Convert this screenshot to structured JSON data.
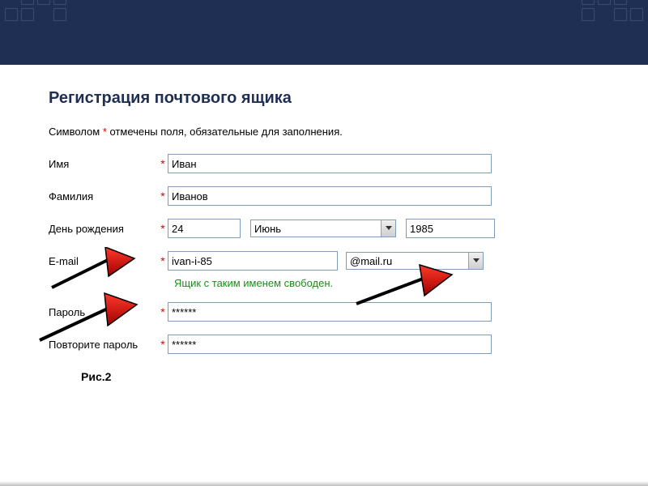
{
  "title": "Регистрация почтового ящика",
  "note_pre": "Символом ",
  "note_star": "*",
  "note_post": " отмечены поля, обязательные для заполнения.",
  "labels": {
    "first_name": "Имя",
    "last_name": "Фамилия",
    "birthday": "День рождения",
    "email": "E-mail",
    "password": "Пароль",
    "password_confirm": "Повторите пароль"
  },
  "values": {
    "first_name": "Иван",
    "last_name": "Иванов",
    "day": "24",
    "month": "Июнь",
    "year": "1985",
    "email_local": "ivan-i-85",
    "email_domain": "@mail.ru",
    "password": "******",
    "password_confirm": "******"
  },
  "availability_msg": "Ящик с таким именем свободен.",
  "caption": "Рис.2"
}
